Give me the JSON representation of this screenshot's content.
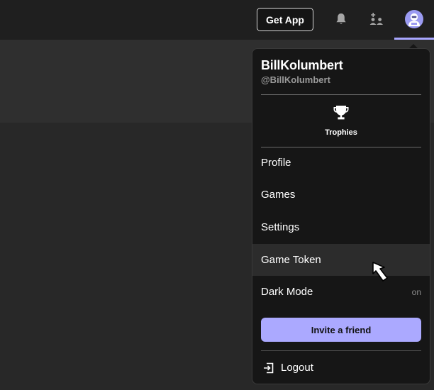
{
  "header": {
    "get_app_label": "Get App",
    "icons": [
      "bell-icon",
      "add-friend-icon",
      "avatar"
    ]
  },
  "user": {
    "display_name": "BillKolumbert",
    "handle": "@BillKolumbert"
  },
  "dropdown": {
    "trophies_label": "Trophies",
    "menu": {
      "profile": "Profile",
      "games": "Games",
      "settings": "Settings",
      "game_token": "Game Token",
      "dark_mode": "Dark Mode",
      "dark_mode_state": "on"
    },
    "invite_label": "Invite a friend",
    "logout_label": "Logout"
  },
  "colors": {
    "accent": "#aba9ff",
    "topbar": "#1f1f1f",
    "dropdown_bg": "#161616",
    "hover_row": "#2c2c2c"
  }
}
